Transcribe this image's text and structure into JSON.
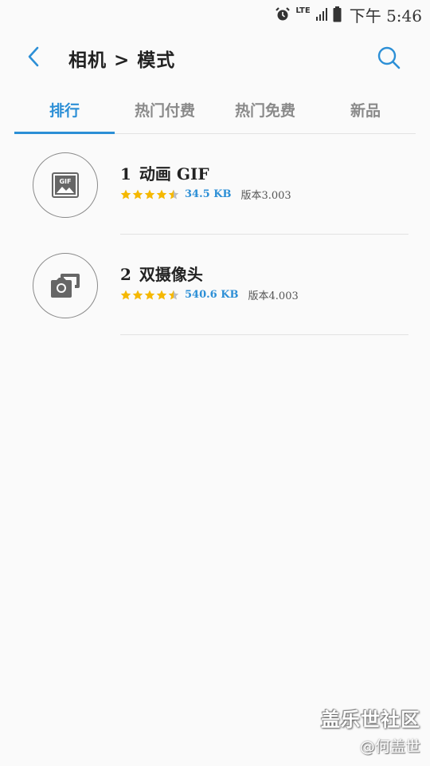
{
  "status_bar": {
    "network": "LTE",
    "time": "下午 5:46",
    "icons": [
      "alarm-icon",
      "lte-icon",
      "signal-icon",
      "battery-icon"
    ]
  },
  "header": {
    "title": "相机 > 模式",
    "back_icon": "chevron-left-icon",
    "search_icon": "search-icon"
  },
  "tabs": [
    {
      "label": "排行",
      "active": true
    },
    {
      "label": "热门付费",
      "active": false
    },
    {
      "label": "热门免费",
      "active": false
    },
    {
      "label": "新品",
      "active": false
    }
  ],
  "items": [
    {
      "rank": "1",
      "name": "动画 GIF",
      "rating": 4.5,
      "size": "34.5 KB",
      "version": "版本3.003",
      "icon": "gif-image-icon"
    },
    {
      "rank": "2",
      "name": "双摄像头",
      "rating": 4.5,
      "size": "540.6 KB",
      "version": "版本4.003",
      "icon": "dual-camera-icon"
    }
  ],
  "watermark": {
    "main": "盖乐世社区",
    "sub": "@何盖世"
  },
  "colors": {
    "accent": "#2c8fd6",
    "star": "#f5b800",
    "background": "#fafafa"
  }
}
